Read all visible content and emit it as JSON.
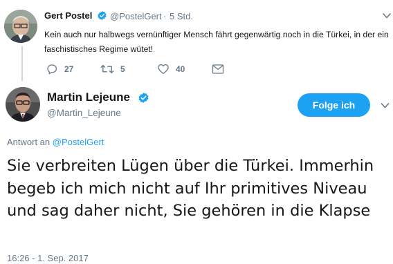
{
  "quoted_tweet": {
    "author_name": "Gert Postel",
    "author_handle": "@PostelGert",
    "separator": "·",
    "time_ago": "5 Std.",
    "text": "Kein auch nur halbwegs vernünftiger Mensch fährt gegenwärtig noch in die Türkei, in der ein faschistisches Regime wütet!",
    "actions": {
      "reply_count": "27",
      "retweet_count": "5",
      "like_count": "40"
    },
    "icons": [
      "verified-icon",
      "chevron-down-icon",
      "reply-icon",
      "retweet-icon",
      "heart-icon",
      "message-icon"
    ]
  },
  "main_tweet": {
    "author_name": "Martin Lejeune",
    "author_handle": "@Martin_Lejeune",
    "follow_label": "Folge ich",
    "reply_prefix": "Antwort an",
    "reply_to_handle": "@PostelGert",
    "text": "Sie verbreiten Lügen über die Türkei. Immerhin begeb ich mich nicht auf Ihr primitives Niveau und sag daher nicht, Sie gehören in die Klapse",
    "timestamp": "16:26 - 1. Sep. 2017"
  },
  "colors": {
    "accent": "#1da1f2",
    "text": "#14171a",
    "muted": "#657786",
    "thread_line": "#ccd6dd"
  }
}
